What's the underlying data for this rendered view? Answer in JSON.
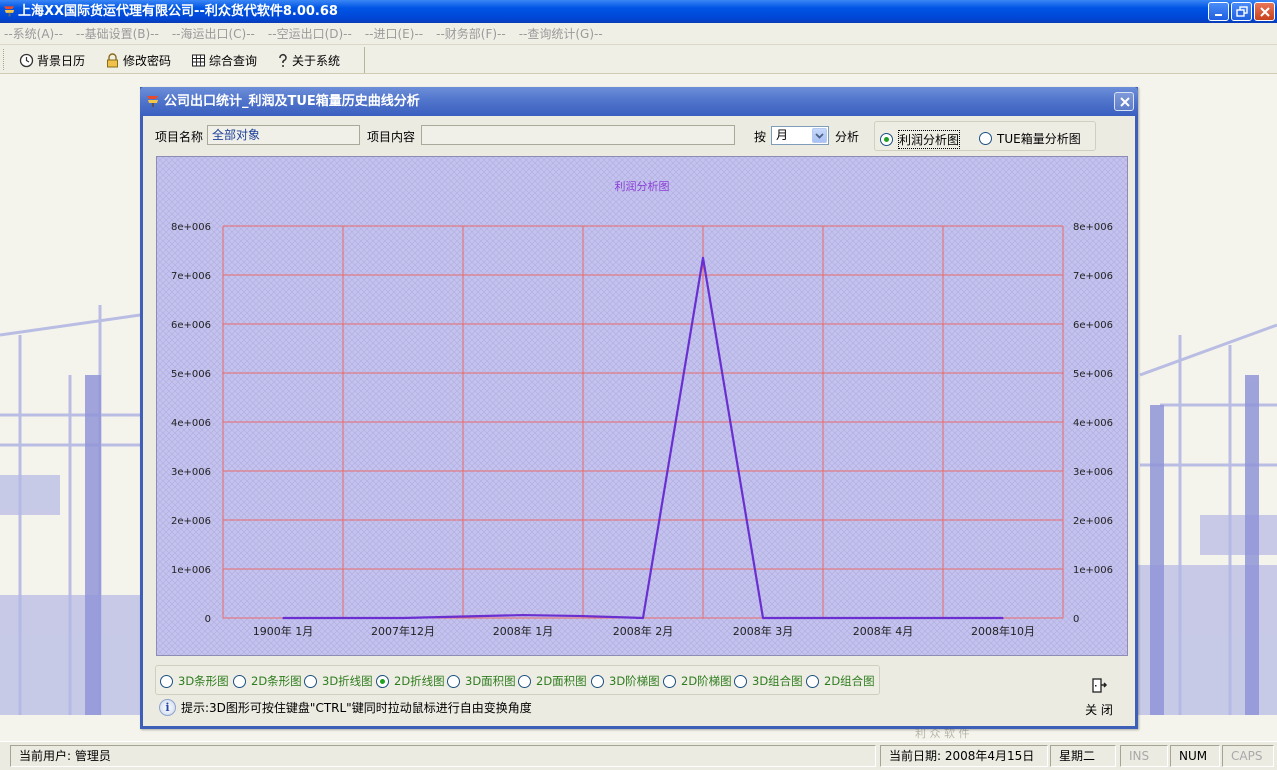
{
  "window": {
    "title": "上海XX国际货运代理有限公司--利众货代软件8.00.68"
  },
  "menu": [
    "--系统(A)--",
    "--基础设置(B)--",
    "--海运出口(C)--",
    "--空运出口(D)--",
    "--进口(E)--",
    "--财务部(F)--",
    "--查询统计(G)--"
  ],
  "toolbar": {
    "calendar_label": "背景日历",
    "password_label": "修改密码",
    "query_label": "综合查询",
    "about_label": "关于系统"
  },
  "dialog": {
    "title": "公司出口统计_利润及TUE箱量历史曲线分析",
    "project_name_label": "项目名称",
    "project_name_value": "全部对象",
    "project_content_label": "项目内容",
    "project_content_value": "",
    "by_label": "按",
    "period_value": "月",
    "analysis_label": "分析",
    "radio_profit": "利润分析图",
    "radio_tue": "TUE箱量分析图",
    "chart_types": [
      "3D条形图",
      "2D条形图",
      "3D折线图",
      "2D折线图",
      "3D面积图",
      "2D面积图",
      "3D阶梯图",
      "2D阶梯图",
      "3D组合图",
      "2D组合图"
    ],
    "selected_chart_type": "2D折线图",
    "hint_text": "提示:3D图形可按住键盘\"CTRL\"键同时拉动鼠标进行自由变换角度",
    "close_label": "关 闭"
  },
  "chart_data": {
    "type": "line",
    "title": "利润分析图",
    "xlabel": "",
    "ylabel": "",
    "categories": [
      "1900年 1月",
      "2007年12月",
      "2008年 1月",
      "2008年 2月",
      "2008年 3月",
      "2008年 4月",
      "2008年10月"
    ],
    "x": [
      0,
      0.5,
      1,
      1.5,
      2,
      2.5,
      3,
      3.5,
      4,
      4.5,
      5,
      5.5,
      6
    ],
    "values": [
      0,
      0,
      0,
      30000,
      60000,
      40000,
      0,
      7350000,
      0,
      0,
      0,
      0,
      0
    ],
    "ylim": [
      0,
      8000000
    ],
    "yticks": [
      "0",
      "1e+006",
      "2e+006",
      "3e+006",
      "4e+006",
      "5e+006",
      "6e+006",
      "7e+006",
      "8e+006"
    ],
    "line_color": "#6a2fd0",
    "grid": true,
    "grid_color": "#e86a6a",
    "background_color": "#c6c4ec",
    "axes_right": true
  },
  "status": {
    "user": "当前用户: 管理员",
    "date": "当前日期: 2008年4月15日",
    "weekday": "星期二",
    "ins": "INS",
    "num": "NUM",
    "caps": "CAPS"
  },
  "watermark": "利 众 软 件"
}
